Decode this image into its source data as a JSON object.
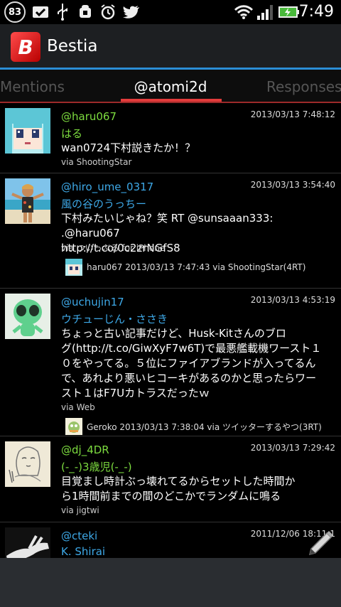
{
  "status_bar": {
    "notification_count": "83",
    "time": "7:49",
    "icons": [
      "mail-check-icon",
      "usb-icon",
      "android-debug-icon",
      "alarm-icon",
      "twitter-icon",
      "wifi-icon",
      "signal-icon",
      "battery-charging-icon"
    ]
  },
  "app": {
    "title": "Bestia",
    "logo_letter": "B"
  },
  "tabs": {
    "left": "Mentions",
    "center": "@atomi2d",
    "right": "Responses"
  },
  "tweets": [
    {
      "handle": "@haru067",
      "name": "はる",
      "date": "2013/03/13 7:48:12",
      "lines": [
        "wan0724下村説きたか！？"
      ],
      "via": "via ShootingStar",
      "color": "green"
    },
    {
      "handle": "@hiro_ume_0317",
      "name": "風の谷のうっちー",
      "date": "2013/03/13 3:54:40",
      "lines": [
        "下村みたいじゃね？笑 RT @sunsaaan333: .@haru067",
        "http://t.co/0c2zrNGfS8"
      ],
      "via": "via ついっぷる for iPhone",
      "retweet": "haru067 2013/03/13 7:47:43 via ShootingStar(4RT)",
      "color": "blue"
    },
    {
      "handle": "@uchujin17",
      "name": "ウチューじん・ささき",
      "date": "2013/03/13 4:53:19",
      "lines": [
        "ちょっと古い記事だけど、Husk-Kitさんのブロ",
        "グ(http://t.co/GiwXyF7w6T)で最悪艦載機ワースト１",
        "０をやってる。５位にファイアブランドが入ってるん",
        "で、あれより悪いヒコーキがあるのかと思ったらワー",
        "スト１はF7Uカトラスだったｗ"
      ],
      "via": "via Web",
      "retweet": "Geroko 2013/03/13 7:38:04 via ツイッターするやつ(3RT)",
      "color": "blue"
    },
    {
      "handle": "@dj_4DR",
      "name": "(-_-)3歳児(-_-)",
      "date": "2013/03/13 7:29:42",
      "lines": [
        "目覚まし時計ぶっ壊れてるからセットした時間か",
        "ら1時間前までの間のどこかでランダムに鳴る"
      ],
      "via": "via jigtwi",
      "color": "green"
    },
    {
      "handle": "@cteki",
      "name": "K. Shirai",
      "date": "2011/12/06 18:11:1",
      "lines": [],
      "via": "",
      "color": "blue"
    }
  ],
  "colors": {
    "accent_blue": "#2b8ed6",
    "accent_red": "#e23b3b",
    "handle_green": "#7ddc3f",
    "handle_blue": "#3ea9e8"
  }
}
